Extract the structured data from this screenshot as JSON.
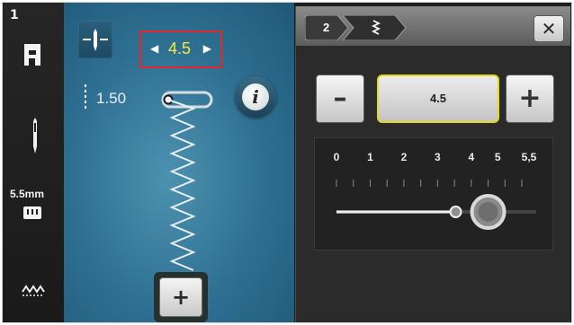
{
  "status_bar": {
    "number": "1",
    "width_label": "5.5mm",
    "icons": [
      "presser-foot-icon",
      "needle-icon",
      "stitch-plate-icon",
      "zigzag-stitch-icon"
    ]
  },
  "stitch_area": {
    "width_value": "4.5",
    "length_value": "1.50",
    "info_label": "i",
    "add_label": "+",
    "colors": {
      "background": "#2e6f91",
      "highlight_border": "#e0282e",
      "value_text": "#f6e84a"
    }
  },
  "panel": {
    "breadcrumb": [
      "2",
      "zigzag-icon"
    ],
    "close_label": "✕",
    "minus_label": "–",
    "plus_label": "+",
    "value": "4.5",
    "scale_labels": [
      "0",
      "1",
      "2",
      "3",
      "4",
      "5",
      "5,5"
    ],
    "scale_min": 0,
    "scale_max": 5.5,
    "slider_value": 4.5,
    "accent": "#e6d81a"
  }
}
